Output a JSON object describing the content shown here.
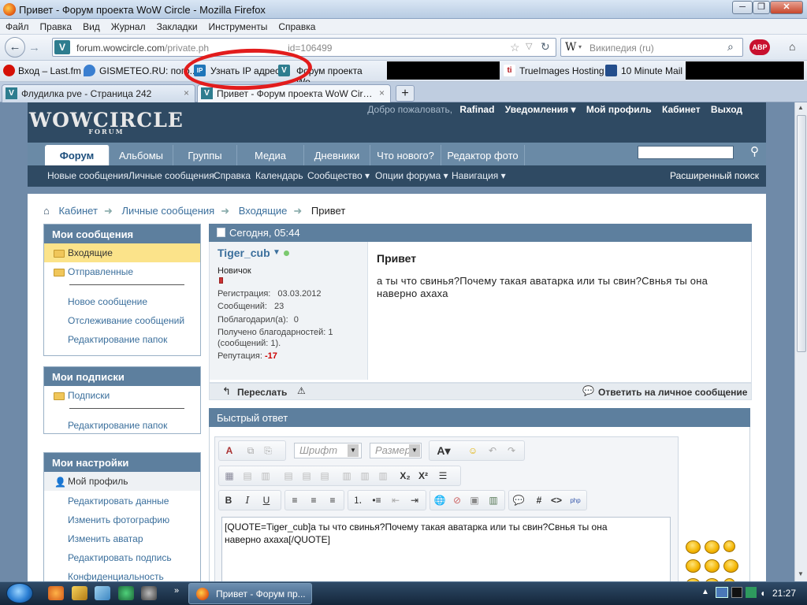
{
  "window": {
    "title": "Привет - Форум проекта WoW Circle - Mozilla Firefox"
  },
  "menu": [
    "Файл",
    "Правка",
    "Вид",
    "Журнал",
    "Закладки",
    "Инструменты",
    "Справка"
  ],
  "nav": {
    "url_host": "forum.wowcircle.com",
    "url_rest_a": "/private.ph",
    "url_rest_b": "id=106499",
    "search_placeholder": "Википедия (ru)",
    "search_engine": "W"
  },
  "bookmarks": [
    {
      "label": "Вход – Last.fm",
      "color": "#d51007"
    },
    {
      "label": "GISMETEO.RU: пого...",
      "color": "#3b7fd0"
    },
    {
      "label": "Узнать IP адрес",
      "color": "#1f76b9"
    },
    {
      "label": "Форум проекта Wo...",
      "color": "#2e7d8f"
    },
    {
      "label": "TrueImages Hosting",
      "color": "#b6171e"
    },
    {
      "label": "10 Minute Mail",
      "color": "#234d8c"
    }
  ],
  "tabs": [
    {
      "label": "Флудилка pve - Страница 242"
    },
    {
      "label": "Привет - Форум проекта WoW Circle"
    }
  ],
  "forum": {
    "logo": "WOWCIRCLE",
    "logo_sub": "FORUM",
    "welcome": "Добро пожаловать,",
    "username": "Rafinad",
    "user_links": [
      "Уведомления ▾",
      "Мой профиль",
      "Кабинет",
      "Выход"
    ],
    "main_tabs": [
      "Форум",
      "Альбомы",
      "Группы",
      "Медиа",
      "Дневники",
      "Что нового?",
      "Редактор фото"
    ],
    "sub_links": [
      "Новые сообщения",
      "Личные сообщения",
      "Справка",
      "Календарь",
      "Сообщество ▾",
      "Опции форума ▾",
      "Навигация ▾"
    ],
    "advanced_search": "Расширенный поиск",
    "breadcrumb": [
      "Кабинет",
      "Личные сообщения",
      "Входящие",
      "Привет"
    ]
  },
  "sidebar": {
    "messages_title": "Мои сообщения",
    "inbox": "Входящие",
    "sent": "Отправленные",
    "message_links": [
      "Новое сообщение",
      "Отслеживание сообщений",
      "Редактирование папок"
    ],
    "subs_title": "Мои подписки",
    "subs": "Подписки",
    "subs_edit": "Редактирование папок",
    "settings_title": "Мои настройки",
    "profile": "Мой профиль",
    "settings_links": [
      "Редактировать данные",
      "Изменить фотографию",
      "Изменить аватар",
      "Редактировать подпись",
      "Конфиденциальность"
    ]
  },
  "message": {
    "date": "Сегодня, 05:44",
    "author": "Tiger_cub",
    "rank": "Новичок",
    "reg_label": "Регистрация:",
    "reg_value": "03.03.2012",
    "posts_label": "Сообщений:",
    "posts_value": "23",
    "thanked_label": "Поблагодарил(а):",
    "thanked_value": "0",
    "received_l1": "Получено благодарностей: 1",
    "received_l2": "(сообщений: 1).",
    "rep_label": "Репутация:",
    "rep_value": "-17",
    "subject": "Привет",
    "body_l1": "а ты что свинья?Почему такая аватарка или ты свин?Свнья ты она",
    "body_l2": "наверно ахаха",
    "forward": "Переслать",
    "reply": "Ответить на личное сообщение"
  },
  "quick_reply": {
    "title": "Быстрый ответ",
    "font_placeholder": "Шрифт",
    "size_placeholder": "Размер",
    "text_l1": "[QUOTE=Tiger_cub]а ты что свинья?Почему такая аватарка или ты свин?Свнья ты она",
    "text_l2": "наверно ахаха[/QUOTE]"
  },
  "taskbar": {
    "task": "Привет - Форум пр...",
    "time": "21:27"
  }
}
